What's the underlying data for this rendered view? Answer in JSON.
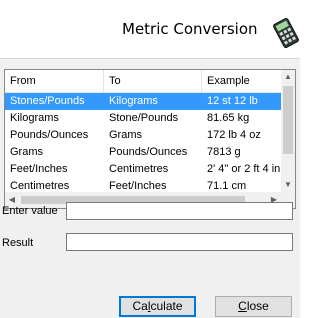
{
  "window": {
    "title": "Metric Conversion",
    "logo_icon": "calculator-icon"
  },
  "table": {
    "columns": [
      "From",
      "To",
      "Example"
    ],
    "rows": [
      {
        "from": "Stones/Pounds",
        "to": "Kilograms",
        "example": "12 st 12 lb",
        "selected": true
      },
      {
        "from": "Kilograms",
        "to": "Stone/Pounds",
        "example": "81.65 kg",
        "selected": false
      },
      {
        "from": "Pounds/Ounces",
        "to": "Grams",
        "example": "172 lb 4 oz",
        "selected": false
      },
      {
        "from": "Grams",
        "to": "Pounds/Ounces",
        "example": "7813 g",
        "selected": false
      },
      {
        "from": "Feet/Inches",
        "to": "Centimetres",
        "example": "2' 4\" or 2 ft 4 in",
        "selected": false
      },
      {
        "from": "Centimetres",
        "to": "Feet/Inches",
        "example": "71.1 cm",
        "selected": false
      }
    ],
    "selection_color": "#3399ff"
  },
  "form": {
    "enter_label": "Enter value",
    "enter_value": "",
    "result_label": "Result",
    "result_value": ""
  },
  "buttons": {
    "calculate_prefix": "Ca",
    "calculate_accel": "l",
    "calculate_suffix": "culate",
    "close_accel": "C",
    "close_suffix": "lose"
  }
}
